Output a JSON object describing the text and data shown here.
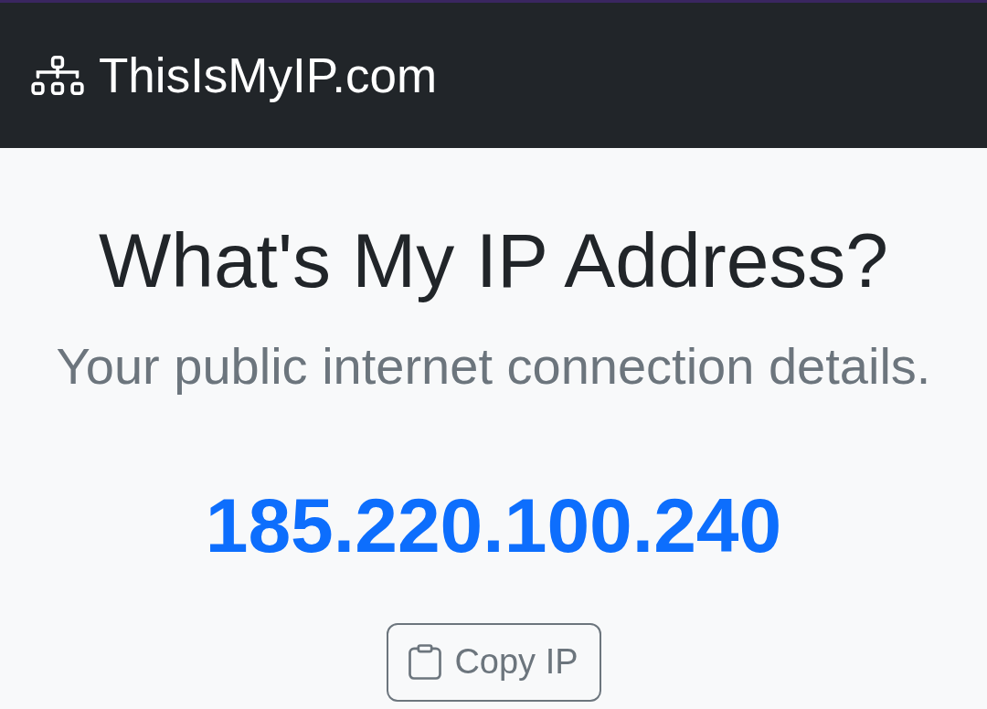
{
  "navbar": {
    "brand": "ThisIsMyIP.com"
  },
  "header": {
    "title": "What's My IP Address?",
    "subtitle": "Your public internet connection details."
  },
  "ip_address": "185.220.100.240",
  "copy_button": {
    "label": "Copy IP"
  }
}
